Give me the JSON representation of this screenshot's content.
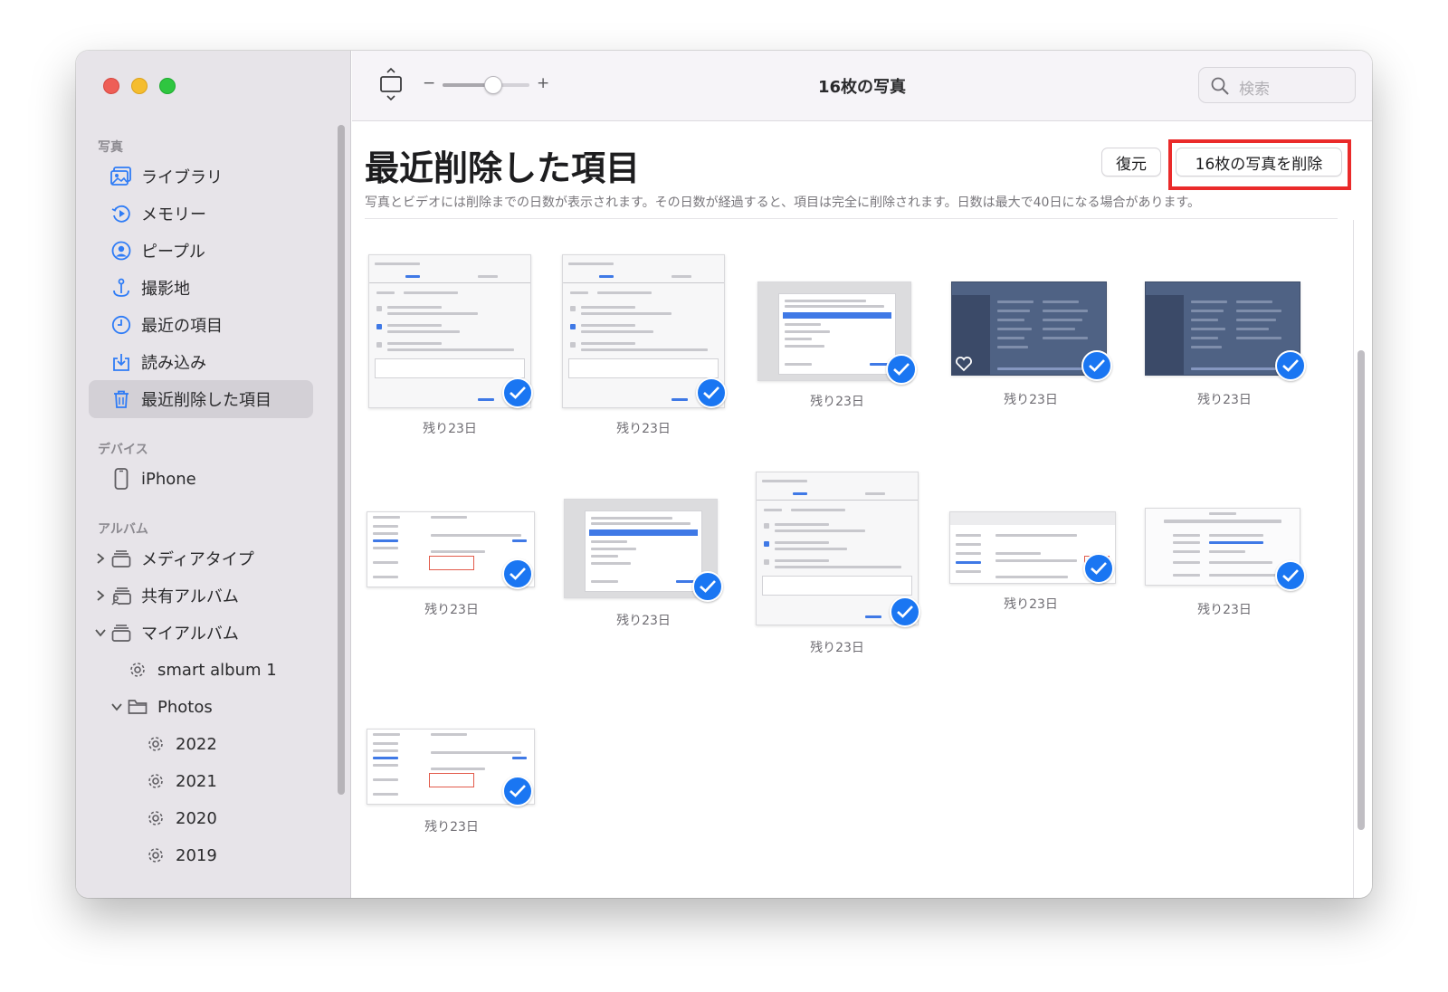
{
  "window": {
    "title": "16枚の写真"
  },
  "toolbar": {
    "zoom_minus": "−",
    "zoom_plus": "+",
    "zoom_level": 0.6,
    "search_placeholder": "検索"
  },
  "sidebar": {
    "sections": {
      "photos": "写真",
      "devices": "デバイス",
      "albums": "アルバム"
    },
    "photos_items": [
      {
        "label": "ライブラリ",
        "icon": "library-icon"
      },
      {
        "label": "メモリー",
        "icon": "memories-icon"
      },
      {
        "label": "ピープル",
        "icon": "people-icon"
      },
      {
        "label": "撮影地",
        "icon": "places-icon"
      },
      {
        "label": "最近の項目",
        "icon": "recents-icon"
      },
      {
        "label": "読み込み",
        "icon": "imports-icon"
      },
      {
        "label": "最近削除した項目",
        "icon": "trash-icon",
        "selected": true
      }
    ],
    "device_items": [
      {
        "label": "iPhone",
        "icon": "iphone-icon"
      }
    ],
    "album_items": [
      {
        "label": "メディアタイプ",
        "icon": "album-stack-icon",
        "expanded": false
      },
      {
        "label": "共有アルバム",
        "icon": "shared-album-icon",
        "expanded": false
      },
      {
        "label": "マイアルバム",
        "icon": "album-stack-icon",
        "expanded": true
      },
      {
        "label": "smart album 1",
        "icon": "smart-album-gear-icon"
      },
      {
        "label": "Photos",
        "icon": "folder-icon",
        "expanded": true
      },
      {
        "label": "2022",
        "icon": "smart-album-gear-icon"
      },
      {
        "label": "2021",
        "icon": "smart-album-gear-icon"
      },
      {
        "label": "2020",
        "icon": "smart-album-gear-icon"
      },
      {
        "label": "2019",
        "icon": "smart-album-gear-icon"
      }
    ]
  },
  "main": {
    "title": "最近削除した項目",
    "recover_label": "復元",
    "delete_label": "16枚の写真を削除",
    "description": "写真とビデオには削除までの日数が表示されます。その日数が経過すると、項目は完全に削除されます。日数は最大で40日になる場合があります。",
    "photos": [
      {
        "caption": "残り23日",
        "kind": "chrome-dialog"
      },
      {
        "caption": "残り23日",
        "kind": "chrome-dialog"
      },
      {
        "caption": "残り23日",
        "kind": "safari-sheet"
      },
      {
        "caption": "残り23日",
        "kind": "dark-app",
        "favorite": true
      },
      {
        "caption": "残り23日",
        "kind": "dark-app"
      },
      {
        "caption": "残り23日",
        "kind": "settings-page"
      },
      {
        "caption": "残り23日",
        "kind": "safari-sheet"
      },
      {
        "caption": "残り23日",
        "kind": "chrome-dialog"
      },
      {
        "caption": "残り23日",
        "kind": "firefox-page"
      },
      {
        "caption": "残り23日",
        "kind": "prefs-page"
      },
      {
        "caption": "残り23日",
        "kind": "settings-page"
      }
    ]
  },
  "colors": {
    "accent": "#1a76f2",
    "highlight": "#ea2a2a",
    "sidebar_bg": "#e7e4e9"
  }
}
